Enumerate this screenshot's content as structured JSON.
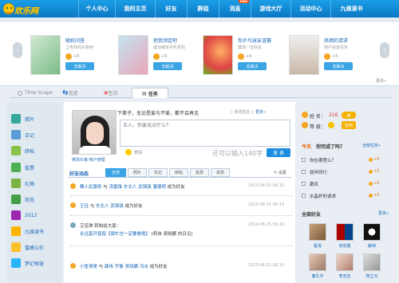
{
  "logo": {
    "text": "欢乐网"
  },
  "nav": {
    "items": [
      "个人中心",
      "我的主页",
      "好友",
      "群组",
      "消息",
      "游戏大厅",
      "活动中心",
      "九维读书"
    ],
    "badge": "new"
  },
  "promo": {
    "cards": [
      {
        "title": "随机问答",
        "sub": "上传你的头像吧",
        "points": "+5",
        "button": "去解决"
      },
      {
        "title": "把我领定吧",
        "sub": "成功绑定手机号码",
        "points": "+5",
        "button": "去解决"
      },
      {
        "title": "你乒乓球友谊赛",
        "sub": "邀请一位好友",
        "points": "+5",
        "button": "去解决"
      },
      {
        "title": "凤栖的请求",
        "sub": "用户完成任务",
        "points": "+5",
        "button": "去解决"
      }
    ],
    "more": "更多»"
  },
  "tabs": {
    "timescape": "Time Scape",
    "footprint": "足迹",
    "birthday": "生日",
    "task": "任务"
  },
  "left_nav": [
    "照片",
    "日记",
    "转帖",
    "投票",
    "礼物",
    "状态",
    "2012",
    "九维读书",
    "蜜蜂公社",
    "梦幻恒宠"
  ],
  "profile": {
    "links": "修改头像  帐户管理",
    "signature": "下辈子，无论是爱与不爱，都不会再见",
    "edit_sig": "[ 修改签名 ]",
    "more": "更多»",
    "status_placeholder": "五人，你要说点什么？",
    "emoticon_label": "表情",
    "counter": "还可以输入140字",
    "publish": "发 表"
  },
  "feed": {
    "title": "好友动态",
    "tabs": [
      "全部",
      "照片",
      "日记",
      "转帖",
      "投票",
      "状态"
    ],
    "settings": "设置",
    "items": [
      {
        "pre": "",
        "links": [
          "舞人民服务",
          "与",
          "汤雷锋",
          "东北人",
          "武锦强",
          "潘德明"
        ],
        "post": "成为好友",
        "time": "2010-08-25 06:19"
      },
      {
        "pre": "",
        "links": [
          "王珏",
          "与",
          "东北人",
          "武锦强"
        ],
        "post": "成为好友",
        "time": "2010-08-25 06:19"
      },
      {
        "pre": "艾佳琪 转帖给大家：",
        "links": [
          "永远莫开窗窗【周忙也一定要看哦】"
        ],
        "post": "(转自 吴晓娜 的日记)",
        "time": "2010-08-25 06:19"
      },
      {
        "pre": "",
        "links": [
          "小鱼哥哥",
          "与",
          "薛伟",
          "齐鲁",
          "吴晓娜",
          "冯冰"
        ],
        "post": "成为好友",
        "time": "2010-08-25 06:19"
      }
    ]
  },
  "right": {
    "name": "姓 名：",
    "name_val": "216",
    "rank": "等 级：",
    "sign_in": "签到",
    "today": "今天",
    "done_q": "你完成了吗？",
    "all_tasks": "全部任务»",
    "tasks": [
      {
        "text": "你在哪里么？",
        "pts": "+5"
      },
      {
        "text": "徒伴同行",
        "pts": "+5"
      },
      {
        "text": "跟风",
        "pts": "+5"
      },
      {
        "text": "水晶杯的请求",
        "pts": "+5"
      }
    ],
    "friends_title": "全部好友",
    "friends_more": "更多»",
    "friends": [
      "崔哥",
      "欢欣勇",
      "薛伟",
      "秦孔平",
      "李吉吉",
      "蒋立元"
    ]
  }
}
